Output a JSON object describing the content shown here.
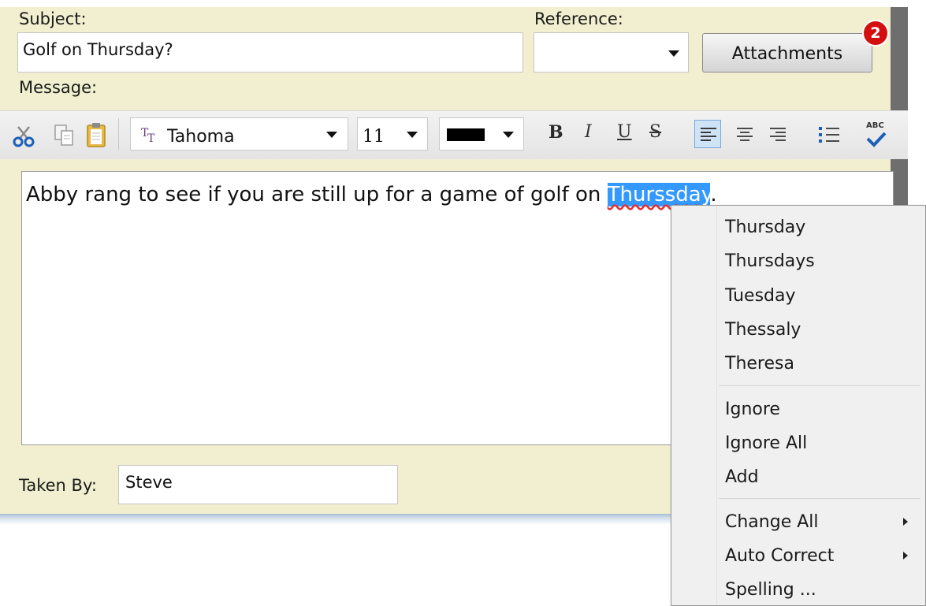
{
  "form": {
    "subject_label": "Subject:",
    "subject_value": "Golf on Thursday?",
    "reference_label": "Reference:",
    "reference_value": "",
    "attachments_label": "Attachments",
    "attachments_count": "2",
    "message_label": "Message:",
    "taken_by_label": "Taken By:",
    "taken_by_value": "Steve"
  },
  "toolbar": {
    "icons": [
      "cut-icon",
      "copy-icon",
      "paste-icon",
      "font-icon",
      "bold",
      "italic",
      "underline",
      "strikethrough",
      "align-left-icon",
      "align-center-icon",
      "align-right-icon",
      "bullet-list-icon",
      "spellcheck-icon"
    ],
    "font_name": "Tahoma",
    "font_size": "11",
    "text_color": "#000000",
    "bold": "B",
    "italic": "I",
    "underline": "U",
    "strike": "S",
    "spell_label": "ABC"
  },
  "editor": {
    "text_before": "Abby rang to see if you are still up for a game of golf on ",
    "misspelled_word": "Thurssday",
    "text_after": "."
  },
  "context_menu": {
    "suggestions": [
      "Thursday",
      "Thursdays",
      "Tuesday",
      "Thessaly",
      "Theresa"
    ],
    "actions": [
      "Ignore",
      "Ignore All",
      "Add"
    ],
    "more": [
      "Change All",
      "Auto Correct",
      "Spelling ..."
    ]
  },
  "colors": {
    "panel_bg": "#f1efcf",
    "selection": "#3399ff",
    "badge": "#d40f0f"
  }
}
